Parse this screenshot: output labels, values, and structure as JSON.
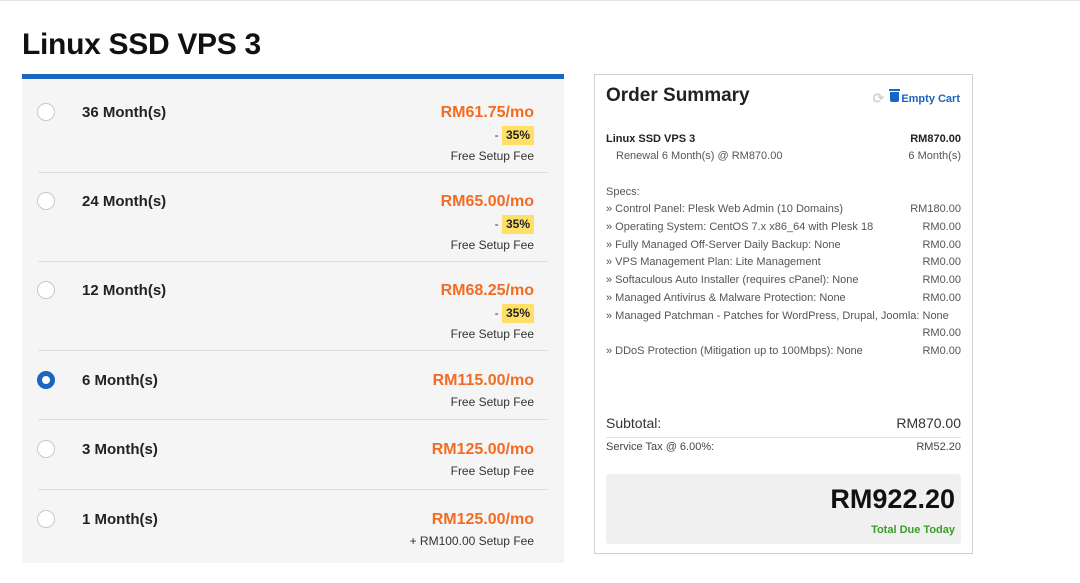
{
  "product_title": "Linux SSD VPS 3",
  "cycles": [
    {
      "label": "36 Month(s)",
      "price": "RM61.75/mo",
      "discount_prefix": "- ",
      "discount": "35%",
      "setup": "Free Setup Fee",
      "selected": false
    },
    {
      "label": "24 Month(s)",
      "price": "RM65.00/mo",
      "discount_prefix": "- ",
      "discount": "35%",
      "setup": "Free Setup Fee",
      "selected": false
    },
    {
      "label": "12 Month(s)",
      "price": "RM68.25/mo",
      "discount_prefix": "- ",
      "discount": "35%",
      "setup": "Free Setup Fee",
      "selected": false
    },
    {
      "label": "6 Month(s)",
      "price": "RM115.00/mo",
      "setup": "Free Setup Fee",
      "selected": true
    },
    {
      "label": "3 Month(s)",
      "price": "RM125.00/mo",
      "setup": "Free Setup Fee",
      "selected": false
    },
    {
      "label": "1 Month(s)",
      "price": "RM125.00/mo",
      "setup": "+ RM100.00 Setup Fee",
      "selected": false
    }
  ],
  "summary": {
    "title": "Order Summary",
    "empty_cart": "Empty Cart",
    "product_name": "Linux SSD VPS 3",
    "product_price": "RM870.00",
    "renewal": "Renewal 6 Month(s) @ RM870.00",
    "renewal_cycle": "6 Month(s)",
    "specs_heading": "Specs:",
    "specs": [
      {
        "label": "» Control Panel: Plesk Web Admin (10 Domains)",
        "price": "RM180.00"
      },
      {
        "label": "» Operating System: CentOS 7.x x86_64 with Plesk 18",
        "price": "RM0.00"
      },
      {
        "label": "» Fully Managed Off-Server Daily Backup: None",
        "price": "RM0.00"
      },
      {
        "label": "» VPS Management Plan: Lite Management",
        "price": "RM0.00"
      },
      {
        "label": "» Softaculous Auto Installer (requires cPanel): None",
        "price": "RM0.00"
      },
      {
        "label": "» Managed Antivirus & Malware Protection: None",
        "price": "RM0.00"
      },
      {
        "label": "» Managed Patchman - Patches for WordPress, Drupal, Joomla: None",
        "price": ""
      },
      {
        "label": "",
        "price": "RM0.00"
      },
      {
        "label": "» DDoS Protection (Mitigation up to 100Mbps): None",
        "price": "RM0.00"
      }
    ],
    "subtotal_label": "Subtotal:",
    "subtotal_value": "RM870.00",
    "tax_label": "Service Tax @ 6.00%:",
    "tax_value": "RM52.20",
    "total_value": "RM922.20",
    "total_label": "Total Due Today"
  },
  "colors": {
    "accent": "#1a65c0",
    "price": "#f36c21",
    "badge": "#ffe066",
    "total_label": "#3a9d23"
  }
}
